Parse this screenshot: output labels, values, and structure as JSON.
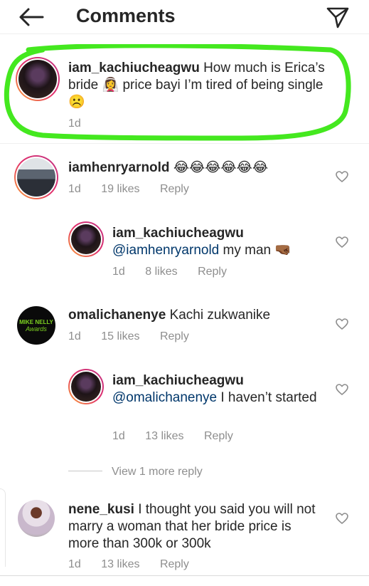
{
  "header": {
    "title": "Comments"
  },
  "caption": {
    "username": "iam_kachiucheagwu",
    "text": "How much is Erica’s bride 👰‍♀️ price bayi I’m tired of being single ☹️",
    "time": "1d"
  },
  "comments": [
    {
      "username": "iamhenryarnold",
      "text": "😂😂😂😂😂😂",
      "time": "1d",
      "likes": "19 likes",
      "reply": "Reply"
    },
    {
      "username": "iam_kachiucheagwu",
      "mention": "@iamhenryarnold",
      "text": "my man 🤜🏾",
      "time": "1d",
      "likes": "8 likes",
      "reply": "Reply"
    },
    {
      "username": "omalichanenye",
      "text": "Kachi zukwanike",
      "time": "1d",
      "likes": "15 likes",
      "reply": "Reply"
    },
    {
      "username": "iam_kachiucheagwu",
      "mention": "@omalichanenye",
      "text": "I haven’t started",
      "time": "1d",
      "likes": "13 likes",
      "reply": "Reply"
    },
    {
      "username": "nene_kusi",
      "text": "I thought you said you will not marry a woman that her bride price is more than 300k or 300k",
      "time": "1d",
      "likes": "13 likes",
      "reply": "Reply"
    }
  ],
  "view_more": "View 1 more reply",
  "avatar_badge": [
    "MIKE NELLY",
    "Awards"
  ],
  "colors": {
    "highlight": "#44e81f",
    "mention": "#00376b",
    "meta": "#8e8e8e"
  }
}
